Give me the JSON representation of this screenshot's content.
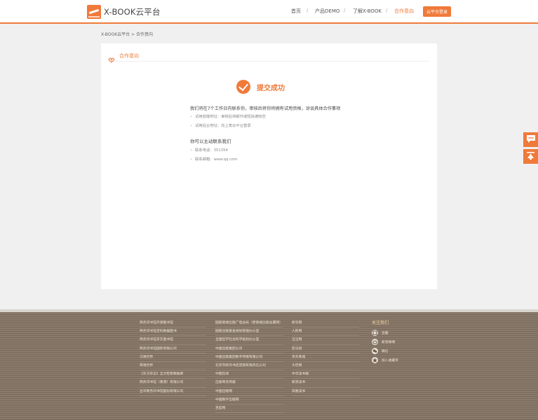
{
  "header": {
    "logo_text": "X-BOOK云平台",
    "nav": [
      {
        "label": "首页"
      },
      {
        "label": "产品DEMO"
      },
      {
        "label": "了解X-BOOK"
      },
      {
        "label": "合作意向"
      }
    ],
    "separator": "/",
    "login_label": "云平台登录",
    "accent_color": "#f07a3a"
  },
  "breadcrumb": "X-BOOK云平台 > 合作意向",
  "card": {
    "title": "合作意向",
    "success_text": "提交成功",
    "message": "我们将在7个工作日内联系你，审核后将你将拥有试用资格，谅谈具体合作事项",
    "bullets": [
      "试用前端地址：审核后将邮件或短信通知您",
      "试用后台地址：向上角云平台登录"
    ],
    "contact_heading": "你可以主动联系我们",
    "contact_items": [
      "联系电话：351354",
      "联系邮箱：www.qq.com"
    ]
  },
  "footer": {
    "col1": [
      "商务印书馆开源图书馆",
      "商务印书馆百科数据图书",
      "商务印书馆京东图书馆",
      "商务印书馆国际有限公司",
      "汉语世界",
      "英语世界",
      "《东方杂志》全文检索数据库",
      "商务印书馆（香港）有限公司",
      "台湾商务印书馆股份有限公司"
    ],
    "col2": [
      "国家新闻出版广电总局（原新闻出版总署网）",
      "国家出版基金规划管理办公室",
      "全国哲学社会科学规划办公室",
      "中国出版集团公司",
      "中国出版集团数字传媒有限公司",
      "北京市新华书店连锁有限责任公司",
      "中图在线",
      "出版商务周报",
      "中国出版网",
      "中国数字出版网",
      "百度网"
    ],
    "col3": [
      "新华网",
      "人民网",
      "当当网",
      "亚马逊",
      "京东商城",
      "大佳网",
      "中华读书报",
      "新浪读书",
      "凤凰读书"
    ],
    "follow_title": "关注我们",
    "follow": [
      {
        "label": "豆瓣",
        "icon": "douban-icon"
      },
      {
        "label": "新浪微博",
        "icon": "weibo-icon"
      },
      {
        "label": "微信",
        "icon": "wechat-icon"
      },
      {
        "label": "加入收藏夹",
        "icon": "star-icon"
      }
    ]
  },
  "float_buttons": [
    {
      "icon": "chat-bubble-icon"
    },
    {
      "icon": "back-to-top-icon"
    }
  ]
}
